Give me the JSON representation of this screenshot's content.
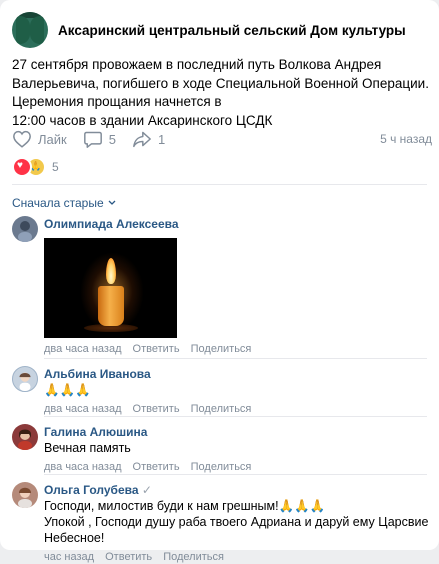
{
  "post": {
    "group_name": "Аксаринский центральный сельский Дом культуры",
    "text": "27 сентября провожаем в последний путь Волкова Андрея Валерьевича, погибшего в ходе Специальной Военной Операции.\nЦеремония прощания начнется в\n12:00 часов в здании Аксаринского ЦСДК",
    "like_label": "Лайк",
    "comments_count": "5",
    "shares_count": "1",
    "time_ago": "5 ч назад",
    "reactions_count": "5"
  },
  "comments_section": {
    "sort_label": "Сначала старые"
  },
  "comments": [
    {
      "author": "Олимпиада Алексеева",
      "text": "",
      "time": "два часа назад",
      "reply_label": "Ответить",
      "share_label": "Поделиться",
      "avatar_color": "#6b7a8f"
    },
    {
      "author": "Альбина Иванова",
      "text": "🙏🙏🙏",
      "time": "два часа назад",
      "reply_label": "Ответить",
      "share_label": "Поделиться",
      "avatar_color": "#c7d3e0"
    },
    {
      "author": "Галина Алюшина",
      "text": "Вечная память",
      "time": "два часа назад",
      "reply_label": "Ответить",
      "share_label": "Поделиться",
      "avatar_color": "#8b3a3a"
    },
    {
      "author": "Ольга Голубева",
      "verified_mark": "✓",
      "text": "Господи, милостив буди к нам грешным!🙏🙏🙏\nУпокой , Господи душу раба твоего Адриана и даруй ему Царсвие Небесное!",
      "time": "час назад",
      "reply_label": "Ответить",
      "share_label": "Поделиться",
      "avatar_color": "#b58a7a"
    }
  ],
  "colors": {
    "link": "#2a5885",
    "muted": "#818c99",
    "heart": "#ff3347"
  }
}
